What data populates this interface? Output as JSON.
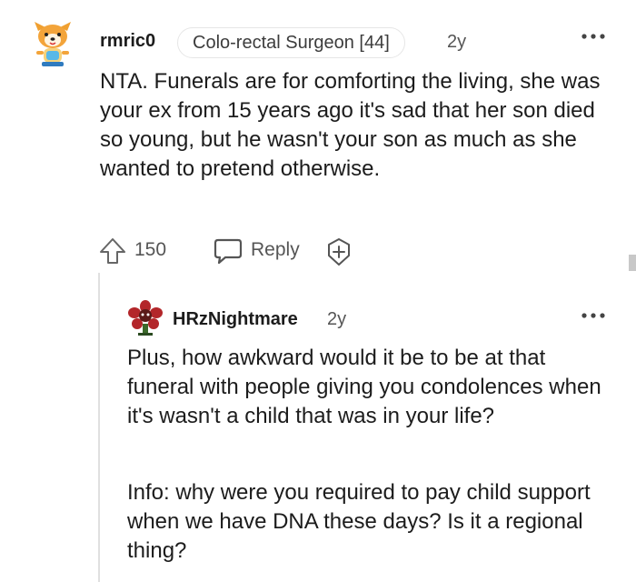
{
  "comment": {
    "username": "rmric0",
    "flair": "Colo-rectal Surgeon [44]",
    "age": "2y",
    "body": "NTA. Funerals are for comforting the living, she was your ex from 15 years ago it's sad that her son died so young, but he wasn't your son as much as she wanted to pretend otherwise.",
    "score": "150",
    "reply_label": "Reply",
    "avatar_icon": "dog-avatar-icon",
    "icons": [
      "more-options-icon",
      "upvote-arrow-icon",
      "reply-bubble-icon",
      "award-plus-icon"
    ]
  },
  "reply": {
    "username": "HRzNightmare",
    "age": "2y",
    "avatar_icon": "flower-avatar-icon",
    "paragraphs": [
      "Plus, how awkward would it be to be at that funeral with people giving you condolences when it's wasn't a child that was in your life?",
      "Info: why were you required to pay child support when we have DNA these days? Is it a regional thing?"
    ]
  },
  "colors": {
    "text": "#1c1c1c",
    "muted": "#555555",
    "thread_line": "#e0e0e0",
    "flair_border": "#e6e6e6"
  }
}
